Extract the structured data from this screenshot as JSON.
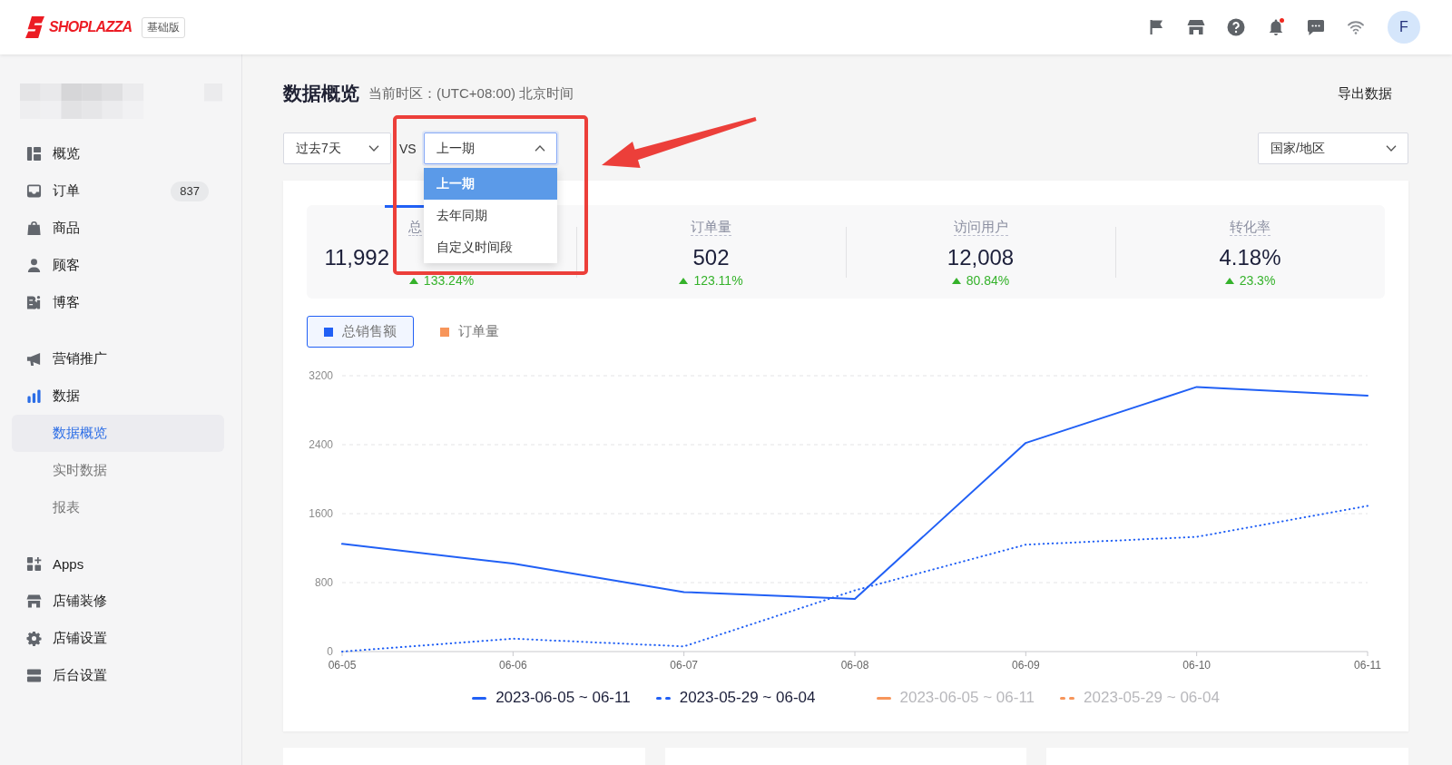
{
  "header": {
    "brand": "SHOPLAZZA",
    "plan_badge": "基础版",
    "notification_dot": true,
    "avatar": "F"
  },
  "sidebar": {
    "groups": [
      [
        {
          "label": "概览",
          "selected": false
        },
        {
          "label": "订单",
          "selected": false,
          "badge": "837"
        },
        {
          "label": "商品",
          "selected": false
        },
        {
          "label": "顾客",
          "selected": false
        },
        {
          "label": "博客",
          "selected": false
        }
      ],
      [
        {
          "label": "营销推广",
          "selected": false
        },
        {
          "label": "数据",
          "selected": false,
          "expanded": true,
          "children": [
            {
              "label": "数据概览",
              "selected": true
            },
            {
              "label": "实时数据",
              "selected": false
            },
            {
              "label": "报表",
              "selected": false
            }
          ]
        }
      ],
      [
        {
          "label": "Apps",
          "selected": false
        },
        {
          "label": "店铺装修",
          "selected": false
        },
        {
          "label": "店铺设置",
          "selected": false
        },
        {
          "label": "后台设置",
          "selected": false
        }
      ]
    ]
  },
  "page": {
    "title": "数据概览",
    "timezone": "当前时区：(UTC+08:00) 北京时间",
    "export_button": "导出数据"
  },
  "filters": {
    "period": {
      "value": "过去7天",
      "open": false
    },
    "vs_label": "VS",
    "compare": {
      "value": "上一期",
      "open": true,
      "options": [
        {
          "label": "上一期",
          "selected": true
        },
        {
          "label": "去年同期",
          "selected": false
        },
        {
          "label": "自定义时间段",
          "selected": false
        }
      ]
    },
    "region": {
      "value": "国家/地区",
      "open": false
    }
  },
  "stats": [
    {
      "label": "总",
      "value": "11,992",
      "change": "133.24%",
      "up": true,
      "selected": true
    },
    {
      "label": "订单量",
      "value": "502",
      "change": "123.11%",
      "up": true,
      "selected": false
    },
    {
      "label": "访问用户",
      "value": "12,008",
      "change": "80.84%",
      "up": true,
      "selected": false
    },
    {
      "label": "转化率",
      "value": "4.18%",
      "change": "23.3%",
      "up": true,
      "selected": false
    }
  ],
  "metric_toggles": [
    {
      "label": "总销售额",
      "color": "#2160f5",
      "selected": true
    },
    {
      "label": "订单量",
      "color": "#f7955a",
      "selected": false
    }
  ],
  "chart": {
    "chart_data": {
      "type": "line",
      "grid": true,
      "categories": [
        "06-05",
        "06-06",
        "06-07",
        "06-08",
        "06-09",
        "06-10",
        "06-11"
      ],
      "ylim": [
        0,
        3200
      ],
      "yticks": [
        0,
        800,
        1600,
        2400,
        3200
      ],
      "series": [
        {
          "name": "2023-06-05 ~ 06-11",
          "color": "#2160f5",
          "line_style": "solid",
          "values": [
            1250,
            1020,
            690,
            610,
            2420,
            3070,
            2970
          ]
        },
        {
          "name": "2023-05-29 ~ 06-04",
          "color": "#2160f5",
          "line_style": "dotted",
          "values": [
            0,
            150,
            60,
            710,
            1240,
            1330,
            1690
          ]
        },
        {
          "name": "2023-06-05 ~ 06-11",
          "color": "#f7955a",
          "line_style": "solid",
          "values": [
            null,
            null,
            null,
            null,
            null,
            null,
            null
          ]
        },
        {
          "name": "2023-05-29 ~ 06-04",
          "color": "#f7955a",
          "line_style": "dotted",
          "values": [
            null,
            null,
            null,
            null,
            null,
            null,
            null
          ]
        }
      ]
    }
  }
}
